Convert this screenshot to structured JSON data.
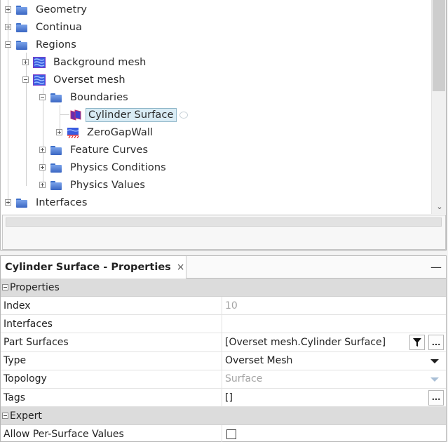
{
  "tree": {
    "nodes": [
      {
        "label": "Geometry",
        "icon": "folder-icon",
        "expanded": false
      },
      {
        "label": "Continua",
        "icon": "folder-icon",
        "expanded": false
      },
      {
        "label": "Regions",
        "icon": "folder-icon",
        "expanded": true
      },
      {
        "label": "Background mesh",
        "icon": "region-mesh-icon",
        "expanded": false
      },
      {
        "label": "Overset mesh",
        "icon": "region-mesh-icon",
        "expanded": true
      },
      {
        "label": "Boundaries",
        "icon": "folder-icon",
        "expanded": true
      },
      {
        "label": "Cylinder Surface",
        "icon": "overset-boundary-icon",
        "selected": true
      },
      {
        "label": "ZeroGapWall",
        "icon": "wall-boundary-icon",
        "expanded": false
      },
      {
        "label": "Feature Curves",
        "icon": "folder-icon",
        "expanded": false
      },
      {
        "label": "Physics Conditions",
        "icon": "folder-icon",
        "expanded": false
      },
      {
        "label": "Physics Values",
        "icon": "folder-icon",
        "expanded": false
      },
      {
        "label": "Interfaces",
        "icon": "folder-icon",
        "expanded": false
      }
    ]
  },
  "properties": {
    "tab_title": "Cylinder Surface - Properties",
    "close_symbol": "×",
    "minimize_symbol": "—",
    "groups": [
      {
        "label": "Properties",
        "rows": [
          {
            "name": "Index",
            "value": "10",
            "disabled": true
          },
          {
            "name": "Interfaces",
            "value": ""
          },
          {
            "name": "Part Surfaces",
            "value": "[Overset mesh.Cylinder Surface]"
          },
          {
            "name": "Type",
            "value": "Overset Mesh"
          },
          {
            "name": "Topology",
            "value": "Surface",
            "disabled": true
          },
          {
            "name": "Tags",
            "value": "[]"
          }
        ]
      },
      {
        "label": "Expert",
        "rows": [
          {
            "name": "Allow Per-Surface Values",
            "value": "",
            "checked": false
          }
        ]
      }
    ],
    "ellipsis_label": "..."
  }
}
